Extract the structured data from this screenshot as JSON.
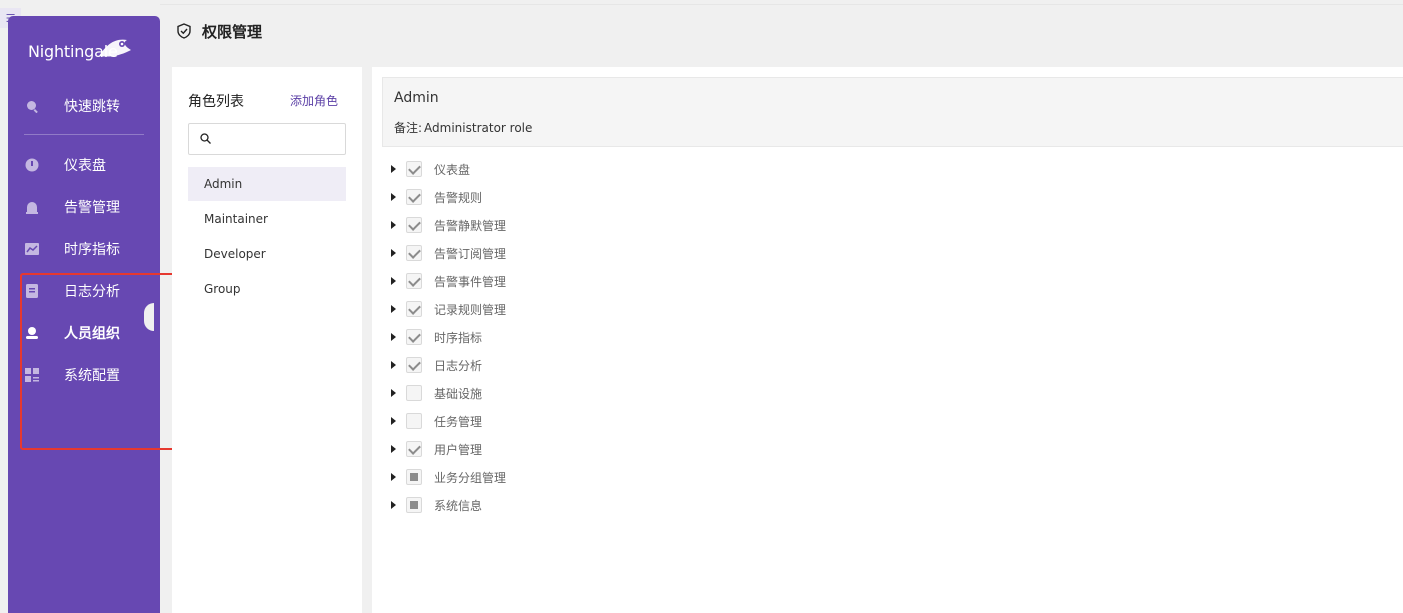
{
  "app": {
    "logo_text": "Nightingale"
  },
  "corner_button": {
    "icon": "menu-collapse-icon"
  },
  "sidebar": {
    "items": [
      {
        "label": "快速跳转",
        "icon": "search-icon"
      },
      {
        "label": "仪表盘",
        "icon": "dashboard-icon"
      },
      {
        "label": "告警管理",
        "icon": "alarm-icon"
      },
      {
        "label": "时序指标",
        "icon": "chart-icon"
      },
      {
        "label": "日志分析",
        "icon": "log-icon"
      },
      {
        "label": "人员组织",
        "icon": "user-icon",
        "active": true
      },
      {
        "label": "系统配置",
        "icon": "settings-grid-icon"
      }
    ]
  },
  "header": {
    "title": "权限管理",
    "icon": "shield-check-icon"
  },
  "role_panel": {
    "title": "角色列表",
    "add_label": "添加角色",
    "search": {
      "placeholder": "",
      "value": ""
    },
    "roles": [
      "Admin",
      "Maintainer",
      "Developer",
      "Group"
    ],
    "selected": "Admin"
  },
  "detail": {
    "name": "Admin",
    "note_label": "备注:",
    "note_value": "Administrator role",
    "permissions": [
      {
        "label": "仪表盘",
        "state": "checked"
      },
      {
        "label": "告警规则",
        "state": "checked"
      },
      {
        "label": "告警静默管理",
        "state": "checked"
      },
      {
        "label": "告警订阅管理",
        "state": "checked"
      },
      {
        "label": "告警事件管理",
        "state": "checked"
      },
      {
        "label": "记录规则管理",
        "state": "checked"
      },
      {
        "label": "时序指标",
        "state": "checked"
      },
      {
        "label": "日志分析",
        "state": "checked"
      },
      {
        "label": "基础设施",
        "state": "unchecked"
      },
      {
        "label": "任务管理",
        "state": "unchecked"
      },
      {
        "label": "用户管理",
        "state": "checked"
      },
      {
        "label": "业务分组管理",
        "state": "partial"
      },
      {
        "label": "系统信息",
        "state": "partial"
      }
    ]
  },
  "colors": {
    "sidebar": "#6748b2",
    "accent": "#5b3fa6",
    "highlight_box": "#e6382f"
  }
}
